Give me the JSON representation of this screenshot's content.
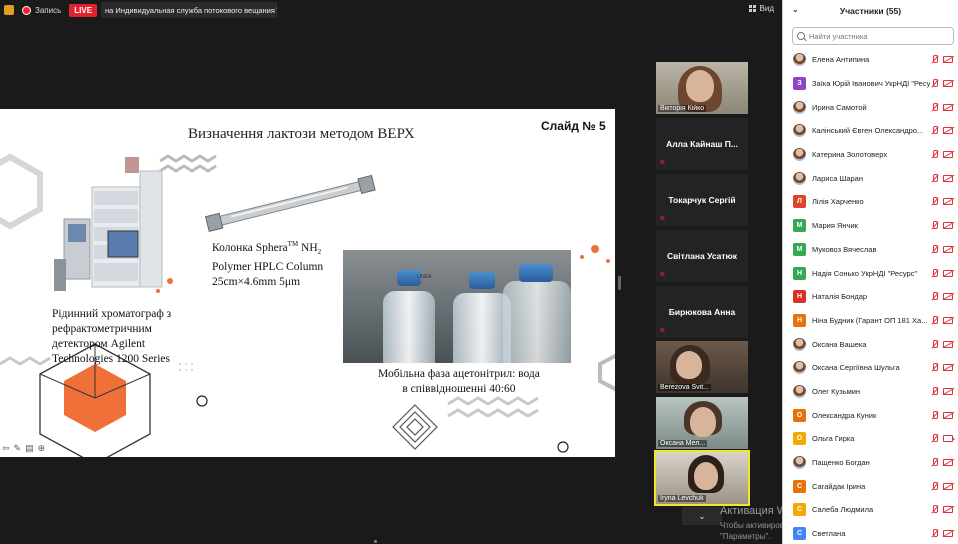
{
  "topbar": {
    "record_label": "Запись",
    "live_label": "LIVE",
    "stream_target": "на Индивидуальная служба потокового вещания",
    "view_label": "Вид"
  },
  "slide": {
    "title": "Визначення лактози методом ВЕРХ",
    "slide_number": "Слайд № 5",
    "hplc_caption": [
      "Рідинний хроматограф з",
      "рефрактометричним",
      "детектором Agilent",
      "Technologies 1200 Series"
    ],
    "column_caption": {
      "line1_prefix": "Колонка Sphera",
      "line1_sup": "TM",
      "line1_suffix": " NH",
      "line1_sub": "2",
      "line2": "Polymer HPLC Column",
      "line3": "25cm×4.6mm 5μm"
    },
    "mobile_caption": [
      "Мобільна фаза ацетонітрил: вода",
      "в співвідношенні 40:60"
    ],
    "bottle_label": "LINEA"
  },
  "video_tiles": [
    {
      "name": "Вікторія Кійко",
      "type": "video"
    },
    {
      "name": "Алла Кайнаш П...",
      "type": "name"
    },
    {
      "name": "Токарчук Сергій",
      "type": "name"
    },
    {
      "name": "Світлана Усатюк",
      "type": "name"
    },
    {
      "name": "Бирюкова Анна",
      "type": "name"
    },
    {
      "name": "Berezova Svit...",
      "type": "video"
    },
    {
      "name": "Оксана Мел...",
      "type": "video"
    },
    {
      "name": "Iryna Levchuk",
      "type": "video"
    }
  ],
  "watermark": {
    "title": "Активация W",
    "text": "Чтобы активировать Windows, перейдите в раздел \"Параметры\"."
  },
  "panel": {
    "title": "Участники (55)",
    "search_placeholder": "Найти участника",
    "participants": [
      {
        "name": "Елена Антипина",
        "initial": "",
        "color": "#6f9f3c",
        "photo": true,
        "cam": "off"
      },
      {
        "name": "Заїка Юрій Іванович УкрНДІ \"Ресу...",
        "initial": "З",
        "color": "#8e44c9",
        "photo": false,
        "cam": "off"
      },
      {
        "name": "Ирина Самотой",
        "initial": "",
        "color": "#999999",
        "photo": true,
        "cam": "off"
      },
      {
        "name": "Калінський Євген Олександро...",
        "initial": "",
        "color": "#999999",
        "photo": true,
        "cam": "off"
      },
      {
        "name": "Катерина Золотоверх",
        "initial": "",
        "color": "#999999",
        "photo": true,
        "cam": "off"
      },
      {
        "name": "Лариса Шаран",
        "initial": "",
        "color": "#999999",
        "photo": true,
        "cam": "off"
      },
      {
        "name": "Лілія Харченко",
        "initial": "Л",
        "color": "#e0452b",
        "photo": false,
        "cam": "off"
      },
      {
        "name": "Мария Янчик",
        "initial": "М",
        "color": "#34a853",
        "photo": false,
        "cam": "off"
      },
      {
        "name": "Муковоз Вячеслав",
        "initial": "М",
        "color": "#34a853",
        "photo": false,
        "cam": "off"
      },
      {
        "name": "Надія Сонько УкрНДІ \"Ресурс\"",
        "initial": "Н",
        "color": "#34a853",
        "photo": false,
        "cam": "off"
      },
      {
        "name": "Наталія Бондар",
        "initial": "Н",
        "color": "#d93025",
        "photo": false,
        "cam": "off"
      },
      {
        "name": "Ніна Будник (Гарант ОП 181 Ха...",
        "initial": "Н",
        "color": "#e8710a",
        "photo": false,
        "cam": "off"
      },
      {
        "name": "Оксана Вашека",
        "initial": "",
        "color": "#999999",
        "photo": true,
        "cam": "off"
      },
      {
        "name": "Оксана Сергіївна Шульга",
        "initial": "",
        "color": "#999999",
        "photo": true,
        "cam": "off"
      },
      {
        "name": "Олег Кузьмин",
        "initial": "",
        "color": "#999999",
        "photo": true,
        "cam": "off"
      },
      {
        "name": "Олександра Куник",
        "initial": "О",
        "color": "#e8710a",
        "photo": false,
        "cam": "off"
      },
      {
        "name": "Ольга Гирка",
        "initial": "О",
        "color": "#f2a900",
        "photo": false,
        "cam": "on"
      },
      {
        "name": "Пащенко Богдан",
        "initial": "",
        "color": "#999999",
        "photo": true,
        "cam": "off"
      },
      {
        "name": "Сагайдак Ірина",
        "initial": "С",
        "color": "#e8710a",
        "photo": false,
        "cam": "off"
      },
      {
        "name": "Салеба Людмила",
        "initial": "С",
        "color": "#f2a900",
        "photo": false,
        "cam": "off"
      },
      {
        "name": "Светлана",
        "initial": "С",
        "color": "#4285f4",
        "photo": false,
        "cam": "off"
      }
    ]
  }
}
